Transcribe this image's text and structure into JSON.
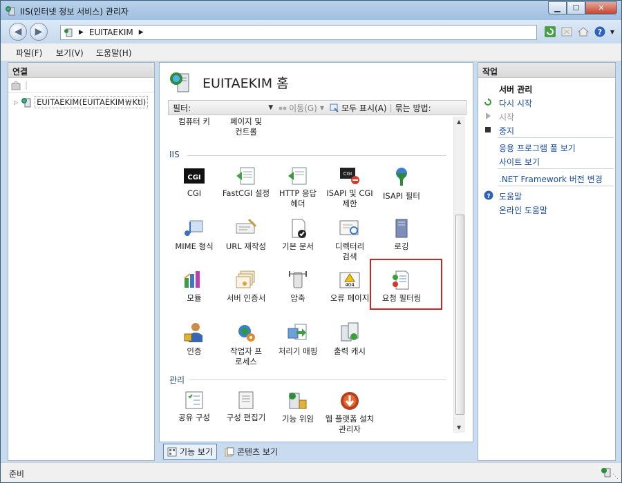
{
  "window": {
    "title": "IIS(인터넷 정보 서비스) 관리자",
    "buttons": {
      "minimize": "▁",
      "maximize": "☐",
      "close": "✕"
    }
  },
  "nav": {
    "back_icon": "back-arrow-icon",
    "forward_icon": "forward-arrow-icon",
    "address_segment": "EUITAEKIM",
    "address_sep1": "▶",
    "address_sep2": "▶"
  },
  "menu": {
    "file": "파일(F)",
    "view": "보기(V)",
    "help": "도움말(H)"
  },
  "connections": {
    "header": "연결",
    "tree_node": "EUITAEKIM(EUITAEKIM￦Ktl)"
  },
  "center": {
    "title": "EUITAEKIM 홈",
    "filter_label": "필터:",
    "go_label": "이동(G)",
    "show_all_label": "모두 표시(A)",
    "group_by_label": "묶는 방법:",
    "top_partial": [
      {
        "label": "컴퓨터 키"
      },
      {
        "label": "페이지 및 컨트롤"
      }
    ],
    "iis_group": "IIS",
    "iis_items": [
      {
        "label": "CGI"
      },
      {
        "label": "FastCGI 설정"
      },
      {
        "label": "HTTP 응답 헤더"
      },
      {
        "label": "ISAPI 및 CGI 제한"
      },
      {
        "label": "ISAPI 필터"
      },
      {
        "label": "MIME 형식"
      },
      {
        "label": "URL 재작성"
      },
      {
        "label": "기본 문서"
      },
      {
        "label": "디렉터리 검색"
      },
      {
        "label": "로깅"
      },
      {
        "label": "모듈"
      },
      {
        "label": "서버 인증서"
      },
      {
        "label": "압축"
      },
      {
        "label": "오류 페이지"
      },
      {
        "label": "요청 필터링"
      },
      {
        "label": "인증"
      },
      {
        "label": "작업자 프로세스"
      },
      {
        "label": "처리기 매핑"
      },
      {
        "label": "출력 캐시"
      }
    ],
    "mgmt_group": "관리",
    "mgmt_items": [
      {
        "label": "공유 구성"
      },
      {
        "label": "구성 편집기"
      },
      {
        "label": "기능 위임"
      },
      {
        "label": "웹 플랫폼 설치 관리자"
      }
    ]
  },
  "viewbar": {
    "features_view": "기능 보기",
    "content_view": "콘텐츠 보기"
  },
  "actions": {
    "header": "작업",
    "server_manage": "서버 관리",
    "restart": "다시 시작",
    "start": "시작",
    "stop": "중지",
    "app_pools": "응용 프로그램 풀 보기",
    "sites": "사이트 보기",
    "net_framework": ".NET Framework 버전 변경",
    "help": "도움말",
    "online_help": "온라인 도움말"
  },
  "status": {
    "text": "준비"
  },
  "colors": {
    "link": "#1a4f9c",
    "highlight_box": "#d8201c",
    "group_label": "#2c4a70"
  }
}
